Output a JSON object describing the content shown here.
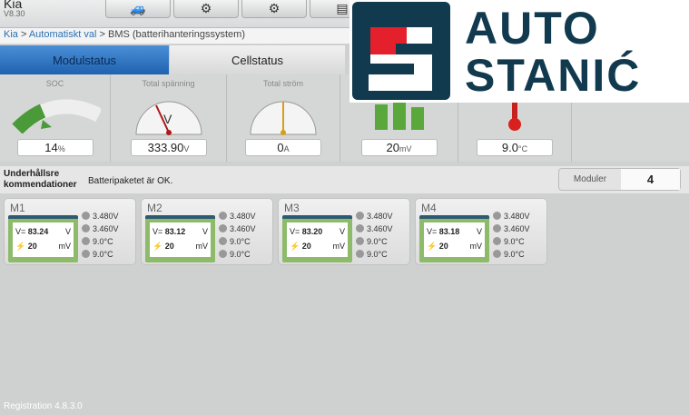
{
  "header": {
    "title": "Kia",
    "version": "V8.30",
    "toolbar": [
      {
        "icon": "car-icon",
        "glyph": "🚙"
      },
      {
        "icon": "vehicle-lift-icon",
        "glyph": "⚙"
      },
      {
        "icon": "gear-icon",
        "glyph": "⚙"
      },
      {
        "icon": "printer-icon",
        "glyph": "▤"
      }
    ]
  },
  "breadcrumb": {
    "items": [
      "Kia",
      "Automatiskt val",
      "BMS (batterihanteringssystem)"
    ],
    "sep": " > "
  },
  "tabs": [
    {
      "label": "Modulstatus",
      "active": true
    },
    {
      "label": "Cellstatus",
      "active": false
    }
  ],
  "gauges": [
    {
      "label": "SOC",
      "value": "14",
      "unit": "%",
      "percent": 14
    },
    {
      "label": "Total spänning",
      "value": "333.90",
      "unit": "V"
    },
    {
      "label": "Total ström",
      "value": "0",
      "unit": "A"
    },
    {
      "label": "",
      "value": "20",
      "unit": "mV"
    },
    {
      "label": "",
      "value": "9.0",
      "unit": "°C"
    }
  ],
  "maintenance": {
    "label": "Underhållsre kommendationer",
    "label1": "Underhållsre",
    "label2": "kommendationer",
    "message": "Batteripaketet är OK."
  },
  "modules_count": {
    "label": "Moduler",
    "value": "4"
  },
  "modules": [
    {
      "name": "M1",
      "voltage": "83.24",
      "vunit": "V",
      "diff": "20",
      "dunit": "mV",
      "vmax": "3.480V",
      "vmin": "3.460V",
      "tmax": "9.0°C",
      "tmin": "9.0°C"
    },
    {
      "name": "M2",
      "voltage": "83.12",
      "vunit": "V",
      "diff": "20",
      "dunit": "mV",
      "vmax": "3.480V",
      "vmin": "3.460V",
      "tmax": "9.0°C",
      "tmin": "9.0°C"
    },
    {
      "name": "M3",
      "voltage": "83.20",
      "vunit": "V",
      "diff": "20",
      "dunit": "mV",
      "vmax": "3.480V",
      "vmin": "3.460V",
      "tmax": "9.0°C",
      "tmin": "9.0°C"
    },
    {
      "name": "M4",
      "voltage": "83.18",
      "vunit": "V",
      "diff": "20",
      "dunit": "mV",
      "vmax": "3.480V",
      "vmin": "3.460V",
      "tmax": "9.0°C",
      "tmin": "9.0°C"
    }
  ],
  "footer": {
    "registration": "Registration 4.8.3.0"
  },
  "logo": {
    "line1": "AUTO",
    "line2": "STANIĆ",
    "colors": {
      "navy": "#123a4f",
      "red": "#e3202b"
    }
  },
  "colors": {
    "tab_active": "#1e62b0",
    "battery_green": "#8dbb6a"
  }
}
